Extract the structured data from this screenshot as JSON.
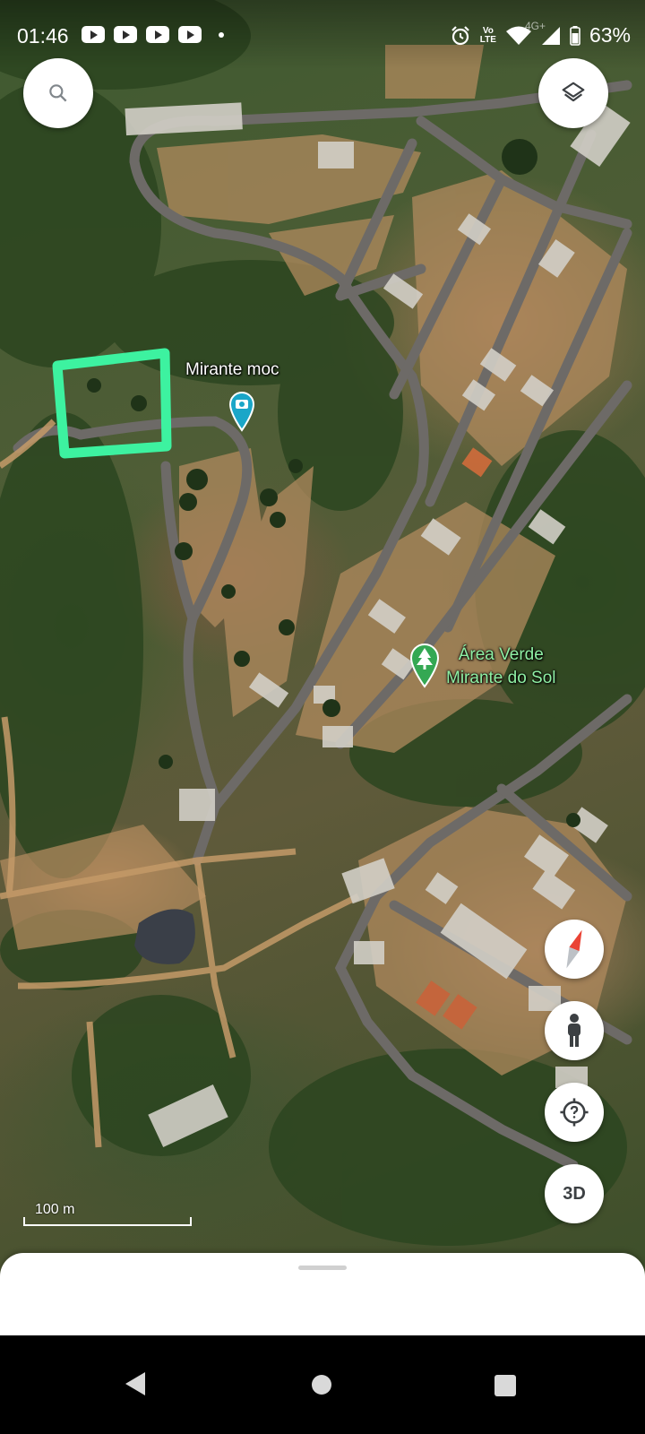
{
  "status_bar": {
    "time": "01:46",
    "notification_icons": [
      "youtube-icon",
      "youtube-icon",
      "youtube-icon",
      "youtube-icon"
    ],
    "volte_line1": "Vo",
    "volte_line2": "LTE",
    "network_type": "4G+",
    "battery": "63%"
  },
  "map": {
    "labels": {
      "mirante_moc": "Mirante moc",
      "area_verde_line1": "Área Verde",
      "area_verde_line2": "Mirante do Sol"
    },
    "scale_label": "100 m",
    "highlight_color": "#3df2a0",
    "pin_colors": {
      "photo": "#1aa6c8",
      "park": "#34a853"
    }
  },
  "controls": {
    "search_icon": "search-icon",
    "layers_icon": "layers-icon",
    "compass_icon": "compass-icon",
    "pegman_icon": "pegman-icon",
    "help_icon": "help-icon",
    "label_3d": "3D"
  },
  "nav_bar": {
    "buttons": [
      "back",
      "home",
      "recents"
    ]
  }
}
